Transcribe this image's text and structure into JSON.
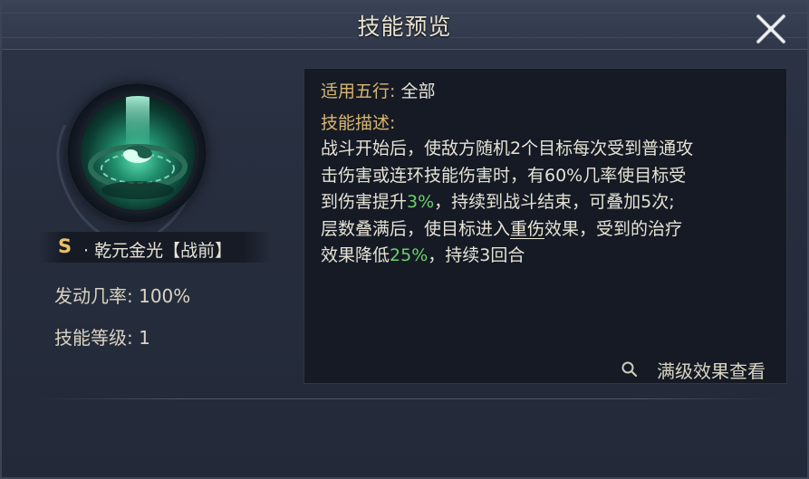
{
  "dialog": {
    "title": "技能预览"
  },
  "skill": {
    "grade": "S",
    "name": "· 乾元金光【战前】",
    "trigger_rate_label": "发动几率:",
    "trigger_rate_value": "100%",
    "level_label": "技能等级:",
    "level_value": "1"
  },
  "details": {
    "element_label": "适用五行:",
    "element_value": "全部",
    "desc_label": "技能描述:",
    "desc_lines": [
      [
        "战斗开始后，使敌方随机2个目标每次受到普通攻"
      ],
      [
        "击伤害或连环技能伤害时，有60%几率使目标受"
      ],
      [
        "到伤害提升",
        "3%",
        "，持续到战斗结束，可叠加5次;"
      ],
      [
        "层数叠满后，使目标进入",
        "重伤",
        "效果，受到的治疗"
      ],
      [
        "效果降低",
        "25%",
        "，持续3回合"
      ]
    ],
    "view_max_label": "满级效果查看"
  },
  "icons": {
    "close": "close-x-icon",
    "search": "search-icon",
    "skill": "yin-yang-skill-icon"
  },
  "colors": {
    "highlight_green": "#6bd16b",
    "grade_gold": "#e8c26a",
    "label_gold": "#d8b66f"
  }
}
